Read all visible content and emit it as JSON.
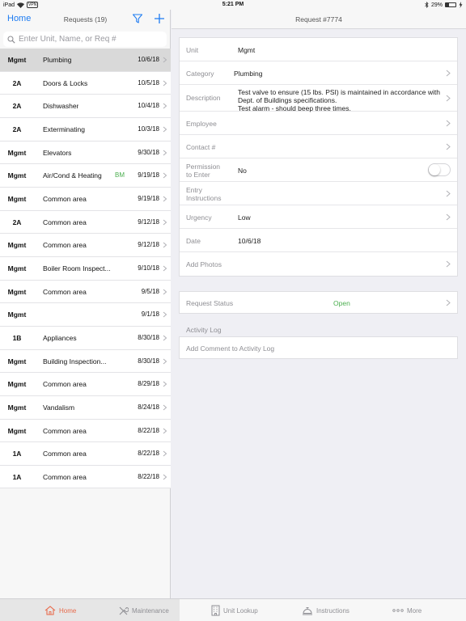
{
  "status_bar": {
    "device": "iPad",
    "vpn": "VPN",
    "time": "5:21 PM",
    "battery": "29%"
  },
  "left": {
    "home": "Home",
    "title": "Requests (19)",
    "search_placeholder": "Enter Unit, Name, or Req #",
    "rows": [
      {
        "unit": "Mgmt",
        "category": "Plumbing",
        "tag": "",
        "date": "10/6/18"
      },
      {
        "unit": "2A",
        "category": "Doors & Locks",
        "tag": "",
        "date": "10/5/18"
      },
      {
        "unit": "2A",
        "category": "Dishwasher",
        "tag": "",
        "date": "10/4/18"
      },
      {
        "unit": "2A",
        "category": "Exterminating",
        "tag": "",
        "date": "10/3/18"
      },
      {
        "unit": "Mgmt",
        "category": "Elevators",
        "tag": "",
        "date": "9/30/18"
      },
      {
        "unit": "Mgmt",
        "category": "Air/Cond & Heating",
        "tag": "BM",
        "date": "9/19/18"
      },
      {
        "unit": "Mgmt",
        "category": "Common area",
        "tag": "",
        "date": "9/19/18"
      },
      {
        "unit": "2A",
        "category": "Common area",
        "tag": "",
        "date": "9/12/18"
      },
      {
        "unit": "Mgmt",
        "category": "Common area",
        "tag": "",
        "date": "9/12/18"
      },
      {
        "unit": "Mgmt",
        "category": "Boiler Room Inspect...",
        "tag": "",
        "date": "9/10/18"
      },
      {
        "unit": "Mgmt",
        "category": "Common area",
        "tag": "",
        "date": "9/5/18"
      },
      {
        "unit": "Mgmt",
        "category": "",
        "tag": "",
        "date": "9/1/18"
      },
      {
        "unit": "1B",
        "category": "Appliances",
        "tag": "",
        "date": "8/30/18"
      },
      {
        "unit": "Mgmt",
        "category": "Building Inspection...",
        "tag": "",
        "date": "8/30/18"
      },
      {
        "unit": "Mgmt",
        "category": "Common area",
        "tag": "",
        "date": "8/29/18"
      },
      {
        "unit": "Mgmt",
        "category": "Vandalism",
        "tag": "",
        "date": "8/24/18"
      },
      {
        "unit": "Mgmt",
        "category": "Common area",
        "tag": "",
        "date": "8/22/18"
      },
      {
        "unit": "1A",
        "category": "Common area",
        "tag": "",
        "date": "8/22/18"
      },
      {
        "unit": "1A",
        "category": "Common area",
        "tag": "",
        "date": "8/22/18"
      }
    ]
  },
  "right": {
    "title": "Request #7774",
    "fields": {
      "unit": {
        "label": "Unit",
        "value": "Mgmt"
      },
      "category": {
        "label": "Category",
        "value": "Plumbing"
      },
      "description": {
        "label": "Description",
        "line1": "Test valve to ensure (15 lbs. PSI) is maintained in accordance with",
        "line2": "Dept. of Buildings specifications.",
        "line3": "Test alarm - should beep three times."
      },
      "employee": {
        "label": "Employee",
        "value": ""
      },
      "contact": {
        "label": "Contact #",
        "value": ""
      },
      "permission": {
        "label1": "Permission",
        "label2": "to Enter",
        "value": "No"
      },
      "entry": {
        "label1": "Entry",
        "label2": "Instructions",
        "value": ""
      },
      "urgency": {
        "label": "Urgency",
        "value": "Low"
      },
      "date": {
        "label": "Date",
        "value": "10/6/18"
      },
      "photos": {
        "label": "Add Photos"
      }
    },
    "status": {
      "label": "Request Status",
      "value": "Open"
    },
    "activity_log": {
      "label": "Activity Log",
      "placeholder": "Add Comment to Activity Log"
    }
  },
  "tabbar": {
    "tabs": [
      {
        "label": "Home",
        "icon": "home-icon"
      },
      {
        "label": "Maintenance",
        "icon": "tools-icon"
      },
      {
        "label": "Unit Lookup",
        "icon": "building-icon"
      },
      {
        "label": "Instructions",
        "icon": "concierge-icon"
      },
      {
        "label": "More",
        "icon": "more-dots-icon"
      }
    ]
  },
  "colors": {
    "accent": "#1e7cf2",
    "active_tab": "#e8694a",
    "status_open": "#4caf50",
    "selected_row": "#d9d9d9"
  }
}
